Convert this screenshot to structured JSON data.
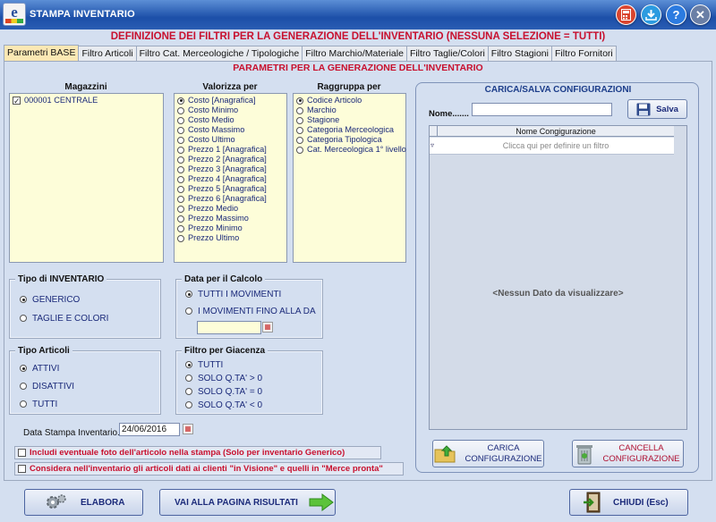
{
  "window": {
    "title": "STAMPA INVENTARIO"
  },
  "title_buttons": [
    "calculator-icon",
    "download-icon",
    "help-icon",
    "close-icon"
  ],
  "heading": "DEFINIZIONE DEI FILTRI PER LA GENERAZIONE DELL'INVENTARIO (NESSUNA SELEZIONE = TUTTI)",
  "tabs": [
    {
      "label": "Parametri BASE",
      "active": true
    },
    {
      "label": "Filtro Articoli"
    },
    {
      "label": "Filtro Cat. Merceologiche / Tipologiche"
    },
    {
      "label": "Filtro Marchio/Materiale"
    },
    {
      "label": "Filtro Taglie/Colori"
    },
    {
      "label": "Filtro Stagioni"
    },
    {
      "label": "Filtro Fornitori"
    }
  ],
  "params_heading": "PARAMETRI PER LA GENERAZIONE DELL'INVENTARIO",
  "magazzini": {
    "label": "Magazzini",
    "items": [
      {
        "label": "000001  CENTRALE",
        "checked": true
      }
    ]
  },
  "valorizza": {
    "label": "Valorizza per",
    "options": [
      "Costo [Anagrafica]",
      "Costo Minimo",
      "Costo Medio",
      "Costo Massimo",
      "Costo Ultimo",
      "Prezzo 1 [Anagrafica]",
      "Prezzo 2 [Anagrafica]",
      "Prezzo 3 [Anagrafica]",
      "Prezzo 4 [Anagrafica]",
      "Prezzo 5 [Anagrafica]",
      "Prezzo 6 [Anagrafica]",
      "Prezzo Medio",
      "Prezzo Massimo",
      "Prezzo Minimo",
      "Prezzo Ultimo"
    ],
    "selected": 0
  },
  "raggruppa": {
    "label": "Raggruppa per",
    "options": [
      "Codice Articolo",
      "Marchio",
      "Stagione",
      "Categoria Merceologica",
      "Categoria Tipologica",
      "Cat. Merceologica 1° livello"
    ],
    "selected": 0
  },
  "tipo_inventario": {
    "label": "Tipo di INVENTARIO",
    "options": [
      "GENERICO",
      "TAGLIE E COLORI"
    ],
    "selected": 0
  },
  "data_calcolo": {
    "label": "Data per il Calcolo",
    "options": [
      "TUTTI I MOVIMENTI",
      "I MOVIMENTI FINO ALLA DA"
    ],
    "selected": 0,
    "date_value": ""
  },
  "tipo_articoli": {
    "label": "Tipo Articoli",
    "options": [
      "ATTIVI",
      "DISATTIVI",
      "TUTTI"
    ],
    "selected": 0
  },
  "filtro_giacenza": {
    "label": "Filtro per Giacenza",
    "options": [
      "TUTTI",
      "SOLO Q.TA' > 0",
      "SOLO Q.TA' = 0",
      "SOLO Q.TA' < 0"
    ],
    "selected": 0
  },
  "data_stampa": {
    "label": "Data Stampa Inventario.",
    "value": "24/06/2016"
  },
  "checks": [
    {
      "label": "Includi eventuale foto dell'articolo nella stampa (Solo per inventario Generico)",
      "checked": false
    },
    {
      "label": "Considera nell'inventario gli articoli dati ai clienti \"in Visione\" e quelli in \"Merce pronta\"",
      "checked": false
    }
  ],
  "config": {
    "title": "CARICA/SALVA  CONFIGURAZIONI",
    "name_label": "Nome.......",
    "name_value": "",
    "save_label": "Salva",
    "grid_header": "Nome Congigurazione",
    "grid_hint": "Clicca qui per definire un filtro",
    "empty_text": "<Nessun Dato da visualizzare>",
    "load_label_1": "CARICA",
    "load_label_2": "CONFIGURAZIONE",
    "delete_label_1": "CANCELLA",
    "delete_label_2": "CONFIGURAZIONE"
  },
  "bottom": {
    "elabora": "ELABORA",
    "risultati": "VAI ALLA PAGINA RISULTATI",
    "chiudi": "CHIUDI  (Esc)"
  },
  "colors": {
    "title_bar": "#1c4fa8",
    "accent_red": "#c8102e",
    "list_bg": "#fdfdd9",
    "panel_bg": "#d4dff0"
  }
}
